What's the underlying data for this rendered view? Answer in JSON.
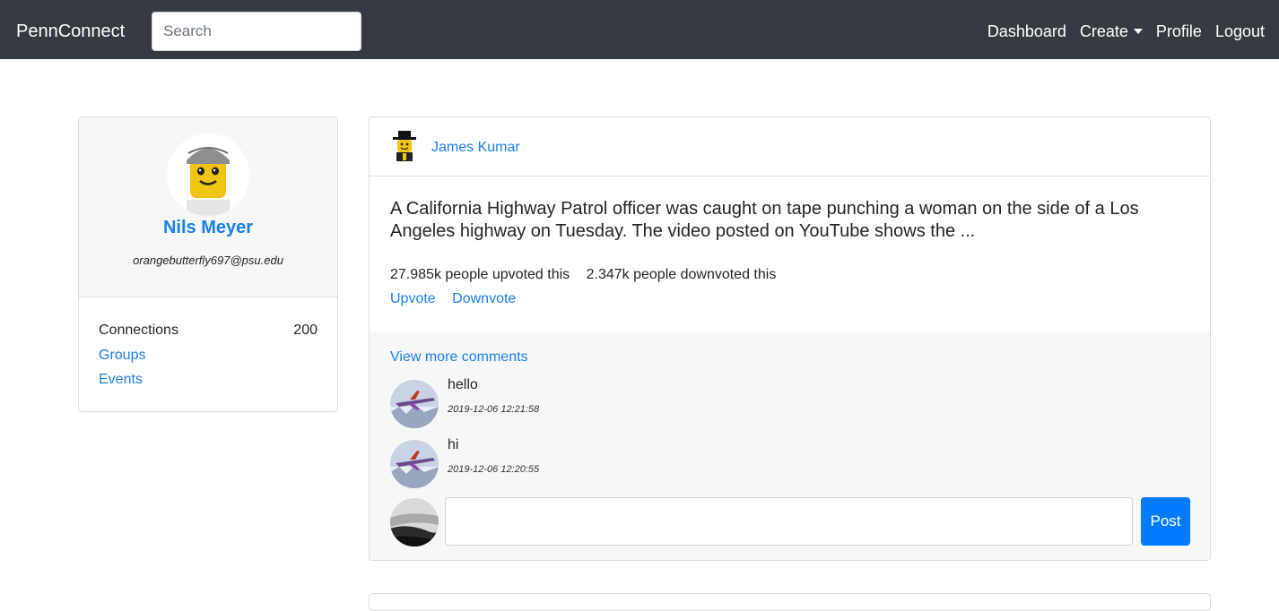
{
  "navbar": {
    "brand": "PennConnect",
    "search_placeholder": "Search",
    "links": {
      "dashboard": "Dashboard",
      "create": "Create",
      "profile": "Profile",
      "logout": "Logout"
    }
  },
  "profile": {
    "name": "Nils Meyer",
    "email": "orangebutterfly697@psu.edu",
    "connections_label": "Connections",
    "connections_count": "200",
    "groups_label": "Groups",
    "events_label": "Events"
  },
  "post": {
    "author": "James Kumar",
    "text": "A California Highway Patrol officer was caught on tape punching a woman on the side of a Los Angeles highway on Tuesday. The video posted on YouTube shows the ...",
    "upvotes_text": "27.985k people upvoted this",
    "downvotes_text": "2.347k people downvoted this",
    "upvote_label": "Upvote",
    "downvote_label": "Downvote",
    "view_more_label": "View more comments",
    "comments": [
      {
        "text": "hello",
        "time": "2019-12-06 12:21:58"
      },
      {
        "text": "hi",
        "time": "2019-12-06 12:20:55"
      }
    ],
    "comment_input_value": "",
    "post_button_label": "Post"
  },
  "colors": {
    "navbar_bg": "#343a40",
    "link": "#1a80e6",
    "primary_button": "#007bff",
    "comments_bg": "#f7f7f7"
  }
}
